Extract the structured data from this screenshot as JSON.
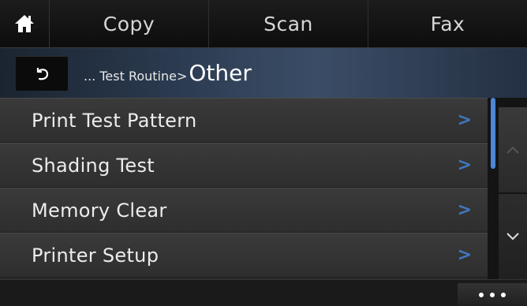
{
  "topbar": {
    "home_icon": "home-icon",
    "tabs": [
      {
        "label": "Copy"
      },
      {
        "label": "Scan"
      },
      {
        "label": "Fax"
      }
    ]
  },
  "header": {
    "back_icon": "back-arrow-icon",
    "breadcrumb_prefix": "... Test Routine>",
    "breadcrumb_current": "Other"
  },
  "list": {
    "items": [
      {
        "label": "Print Test Pattern",
        "chevron": ">"
      },
      {
        "label": "Shading Test",
        "chevron": ">"
      },
      {
        "label": "Memory Clear",
        "chevron": ">"
      },
      {
        "label": "Printer Setup",
        "chevron": ">"
      }
    ]
  },
  "scroll": {
    "up_icon": "chevron-up-icon",
    "down_icon": "chevron-down-icon"
  },
  "bottombar": {
    "more_icon": "more-dots-icon"
  },
  "colors": {
    "accent": "#4d86d6",
    "chevron": "#3e78c0"
  }
}
